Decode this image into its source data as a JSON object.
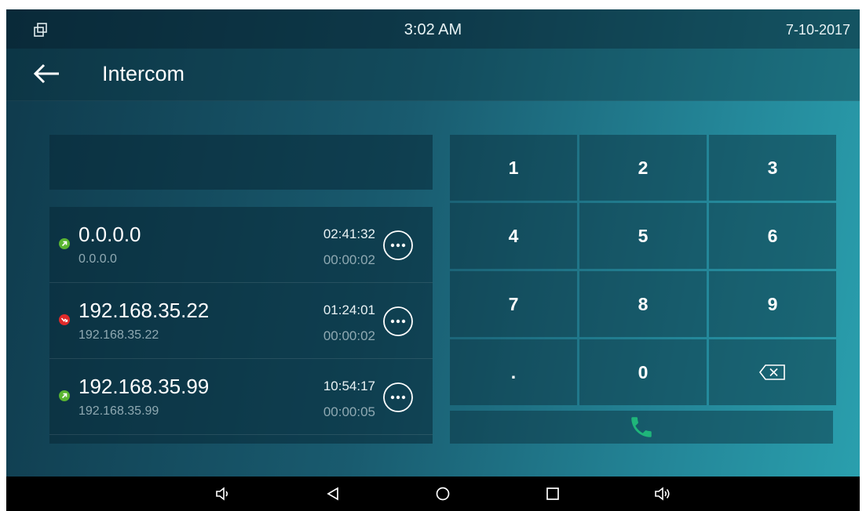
{
  "status_bar": {
    "left_icon": "multi-window-icon",
    "time": "3:02 AM",
    "date": "7-10-2017"
  },
  "header": {
    "back_icon": "arrow-left-icon",
    "title": "Intercom"
  },
  "dial_input": {
    "value": ""
  },
  "call_log": [
    {
      "name": "0.0.0.0",
      "address": "0.0.0.0",
      "time": "02:41:32",
      "duration": "00:00:02",
      "call_type": "outgoing",
      "status_color": "#5ab531",
      "status_icon": "outgoing-call-icon",
      "more_icon": "more-options-icon"
    },
    {
      "name": "192.168.35.22",
      "address": "192.168.35.22",
      "time": "01:24:01",
      "duration": "00:00:02",
      "call_type": "missed",
      "status_color": "#e02a2a",
      "status_icon": "missed-call-icon",
      "more_icon": "more-options-icon"
    },
    {
      "name": "192.168.35.99",
      "address": "192.168.35.99",
      "time": "10:54:17",
      "duration": "00:00:05",
      "call_type": "outgoing",
      "status_color": "#5ab531",
      "status_icon": "outgoing-call-icon",
      "more_icon": "more-options-icon"
    }
  ],
  "keypad": {
    "keys": [
      "1",
      "2",
      "3",
      "4",
      "5",
      "6",
      "7",
      "8",
      "9",
      ".",
      "0"
    ],
    "backspace_icon": "backspace-icon",
    "call_icon": "phone-icon",
    "call_color": "#1fb57a"
  },
  "nav_bar": {
    "buttons": [
      "volume-down-icon",
      "back-triangle-icon",
      "home-circle-icon",
      "recents-square-icon",
      "volume-up-icon"
    ]
  }
}
